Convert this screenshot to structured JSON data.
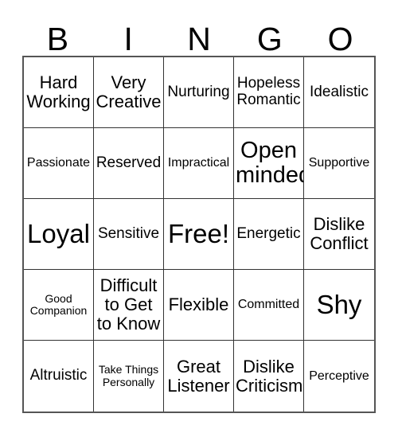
{
  "card": {
    "header_letters": [
      "B",
      "I",
      "N",
      "G",
      "O"
    ],
    "rows": [
      [
        {
          "text": "Hard Working",
          "size": "lg"
        },
        {
          "text": "Very Creative",
          "size": "lg"
        },
        {
          "text": "Nurturing",
          "size": "md"
        },
        {
          "text": "Hopeless Romantic",
          "size": "md"
        },
        {
          "text": "Idealistic",
          "size": "md"
        }
      ],
      [
        {
          "text": "Passionate",
          "size": "sm"
        },
        {
          "text": "Reserved",
          "size": "md"
        },
        {
          "text": "Impractical",
          "size": "sm"
        },
        {
          "text": "Open minded",
          "size": "xl"
        },
        {
          "text": "Supportive",
          "size": "sm"
        }
      ],
      [
        {
          "text": "Loyal",
          "size": "xxl"
        },
        {
          "text": "Sensitive",
          "size": "md"
        },
        {
          "text": "Free!",
          "size": "xxl"
        },
        {
          "text": "Energetic",
          "size": "md"
        },
        {
          "text": "Dislike Conflict",
          "size": "lg"
        }
      ],
      [
        {
          "text": "Good Companion",
          "size": "xs"
        },
        {
          "text": "Difficult to Get to Know",
          "size": "lg"
        },
        {
          "text": "Flexible",
          "size": "lg"
        },
        {
          "text": "Committed",
          "size": "sm"
        },
        {
          "text": "Shy",
          "size": "xxl"
        }
      ],
      [
        {
          "text": "Altruistic",
          "size": "md"
        },
        {
          "text": "Take Things Personally",
          "size": "xs"
        },
        {
          "text": "Great Listener",
          "size": "lg"
        },
        {
          "text": "Dislike Criticism",
          "size": "lg"
        },
        {
          "text": "Perceptive",
          "size": "sm"
        }
      ]
    ]
  },
  "colors": {
    "background": "#ffffff",
    "text": "#000000",
    "grid_line": "#333333",
    "card_border": "#555555"
  }
}
